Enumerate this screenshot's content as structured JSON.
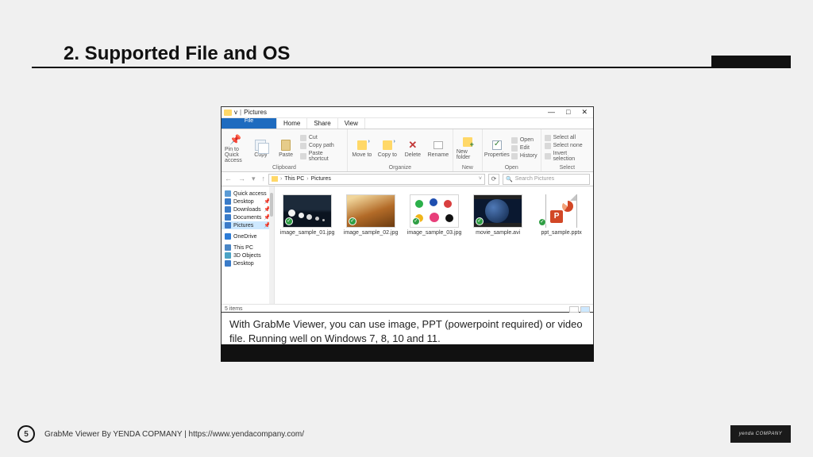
{
  "slide": {
    "title": "2. Supported File and OS",
    "page": "5"
  },
  "footer": {
    "text": "GrabMe Viewer By YENDA COPMANY | https://www.yendacompany.com/",
    "logo": "yenda"
  },
  "caption": "With GrabMe Viewer, you can use image, PPT (powerpoint required) or video file. Running well on Windows 7, 8, 10 and 11.",
  "explorer": {
    "title_drive": "v",
    "title_folder": "Pictures",
    "tabs": {
      "file": "File",
      "home": "Home",
      "share": "Share",
      "view": "View"
    },
    "ribbon": {
      "clipboard": {
        "pin": "Pin to Quick access",
        "copy": "Copy",
        "paste": "Paste",
        "cut": "Cut",
        "copypath": "Copy path",
        "pasteshortcut": "Paste shortcut",
        "group": "Clipboard"
      },
      "organize": {
        "moveto": "Move to",
        "copyto": "Copy to",
        "delete": "Delete",
        "rename": "Rename",
        "group": "Organize"
      },
      "new": {
        "newfolder": "New folder",
        "group": "New"
      },
      "open": {
        "properties": "Properties",
        "open": "Open",
        "edit": "Edit",
        "history": "History",
        "group": "Open"
      },
      "select": {
        "all": "Select all",
        "none": "Select none",
        "invert": "Invert selection",
        "group": "Select"
      }
    },
    "breadcrumb": {
      "root": "This PC",
      "folder": "Pictures"
    },
    "search_placeholder": "Search Pictures",
    "sidebar": {
      "quick": "Quick access",
      "desktop": "Desktop",
      "downloads": "Downloads",
      "documents": "Documents",
      "pictures": "Pictures",
      "onedrive": "OneDrive",
      "thispc": "This PC",
      "objects3d": "3D Objects",
      "desktop2": "Desktop"
    },
    "files": [
      {
        "name": "image_sample_01.jpg"
      },
      {
        "name": "image_sample_02.jpg"
      },
      {
        "name": "image_sample_03.jpg"
      },
      {
        "name": "movie_sample.avi"
      },
      {
        "name": "ppt_sample.pptx"
      }
    ],
    "status": "5 items"
  }
}
